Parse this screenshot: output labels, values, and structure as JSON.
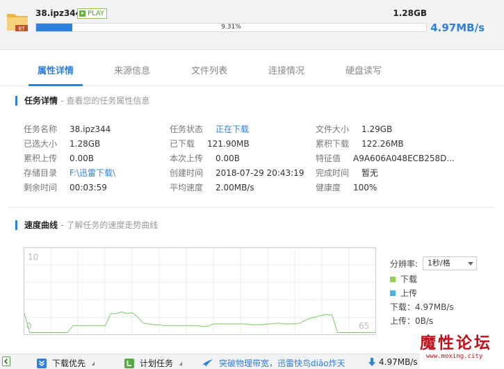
{
  "header": {
    "file_name": "38.ipz344",
    "play_label": "PLAY",
    "file_badge": "BT",
    "downloaded_size": "1.28GB",
    "progress_percent": 9.31,
    "progress_label": "9.31%",
    "speed": "4.97MB/s"
  },
  "tabs": [
    {
      "label": "属性详情",
      "active": true
    },
    {
      "label": "来源信息",
      "active": false
    },
    {
      "label": "文件列表",
      "active": false
    },
    {
      "label": "连接情况",
      "active": false
    },
    {
      "label": "硬盘读写",
      "active": false
    }
  ],
  "task_details": {
    "title": "任务详情",
    "subtitle": "- 查看您的任务属性信息",
    "col1": [
      {
        "key": "任务名称",
        "value": "38.ipz344"
      },
      {
        "key": "已选大小",
        "value": "1.28GB"
      },
      {
        "key": "累积上传",
        "value": "0.00B"
      },
      {
        "key": "存储目录",
        "value": "F:\\迅雷下载\\"
      },
      {
        "key": "剩余时间",
        "value": "00:03:59"
      }
    ],
    "col2": [
      {
        "key": "任务状态",
        "value": "正在下载"
      },
      {
        "key": "已下载",
        "value": "121.90MB"
      },
      {
        "key": "本次上传",
        "value": "0.00B"
      },
      {
        "key": "创建时间",
        "value": "2018-07-29 20:43:19"
      },
      {
        "key": "平均速度",
        "value": "2.00MB/s"
      }
    ],
    "col3": [
      {
        "key": "文件大小",
        "value": "1.29GB"
      },
      {
        "key": "累积下载",
        "value": "122.26MB"
      },
      {
        "key": "特征值",
        "value": "A9A606A048ECB258D..."
      },
      {
        "key": "完成时间",
        "value": "暂无"
      },
      {
        "key": "健康度",
        "value": "100%"
      }
    ]
  },
  "speed_curve": {
    "title": "速度曲线",
    "subtitle": "- 了解任务的速度走势曲线",
    "resolution_label": "分辨率:",
    "resolution_value": "1秒/格",
    "legend_download": "下载",
    "legend_upload": "上传",
    "download_speed": "下载：4.97MB/s",
    "upload_speed": "上传：0B/s",
    "colors": {
      "download": "#8fd14f",
      "upload": "#4ab0e8",
      "line": "#7cc86a"
    }
  },
  "chart_data": {
    "type": "line",
    "y_top_label": "10",
    "x_left_label": "0",
    "x_right_label": "65",
    "ylim": [
      0,
      10
    ],
    "xlim": [
      0,
      65
    ],
    "grid": true,
    "series": [
      {
        "name": "下载",
        "x": [
          0,
          1,
          2,
          3,
          4,
          5,
          6,
          7,
          8,
          9,
          10,
          11,
          12,
          13,
          14,
          15,
          16,
          17,
          18,
          19,
          20,
          21,
          22,
          23,
          24,
          25,
          26,
          27,
          28,
          29,
          30,
          31,
          32,
          33,
          34,
          35,
          36,
          37,
          38,
          39,
          40,
          41,
          42,
          43,
          44,
          45,
          46,
          47,
          48,
          49,
          50,
          51,
          52,
          53,
          54,
          55,
          56,
          57,
          58,
          59,
          60,
          61,
          62,
          63,
          64,
          65
        ],
        "y": [
          2.4,
          0.2,
          0.2,
          0.2,
          0.2,
          0.2,
          0.2,
          0.2,
          0.2,
          1.0,
          1.0,
          1.0,
          1.0,
          1.0,
          1.0,
          1.0,
          2.4,
          2.4,
          2.6,
          2.4,
          2.5,
          2.0,
          1.3,
          1.2,
          1.1,
          1.1,
          1.0,
          1.0,
          1.0,
          1.0,
          1.0,
          1.0,
          1.0,
          0.9,
          0.9,
          1.2,
          1.2,
          1.2,
          1.2,
          1.2,
          1.2,
          1.2,
          1.1,
          1.1,
          1.1,
          1.2,
          1.2,
          1.3,
          1.2,
          1.2,
          1.2,
          1.3,
          1.6,
          1.9,
          2.0,
          2.2,
          2.3,
          2.2,
          0.2,
          0.2,
          0.2,
          0.2,
          0.2,
          0.2,
          0.2,
          0.2
        ]
      }
    ]
  },
  "bottom_bar": {
    "priority": "下载优先",
    "plan": "计划任务",
    "promo": "突破物理带宽，迅雷快鸟diāo炸天",
    "speed": "4.97MB/s"
  },
  "watermark": {
    "big": "魔性论坛",
    "small": "www.moxing.city"
  }
}
